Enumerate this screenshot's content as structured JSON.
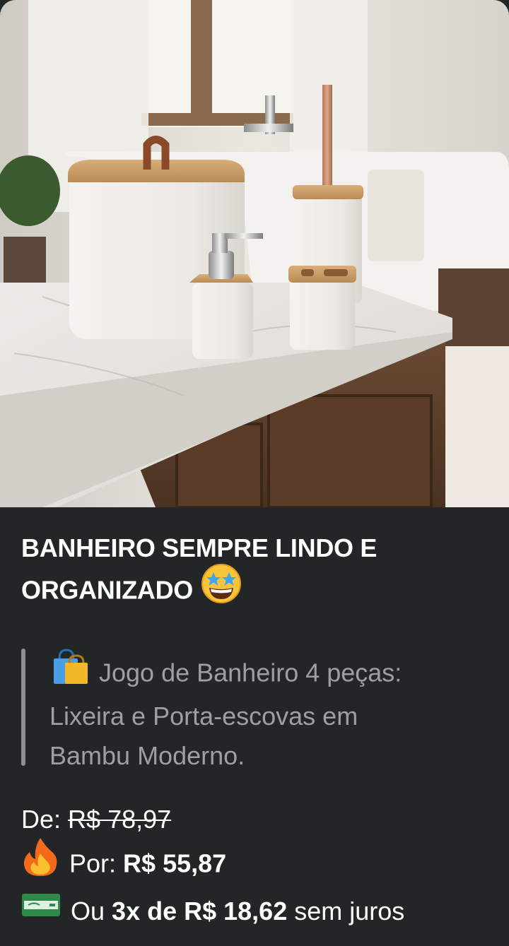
{
  "post": {
    "headline_lines": [
      "BANHEIRO SEMPRE LINDO E",
      "ORGANIZADO"
    ],
    "headline_emoji": "star-struck-face-icon",
    "quote": {
      "icon": "shopping-bags-icon",
      "lines": [
        "Jogo de Banheiro 4 peças:",
        "Lixeira e Porta-escovas em",
        "Bambu Moderno."
      ]
    },
    "price": {
      "old_label": "De:",
      "old_value": "R$ 78,97",
      "new_icon": "fire-icon",
      "new_label": "Por:",
      "new_value": "R$ 55,87",
      "installments_icon": "banknote-icon",
      "installments_prefix": "Ou",
      "installments_value": "3x de R$ 18,62",
      "installments_suffix": "sem juros"
    }
  },
  "colors": {
    "background": "#232626",
    "text": "#ffffff",
    "quote_text": "#9da0a0",
    "quote_bar": "#8d9090"
  }
}
